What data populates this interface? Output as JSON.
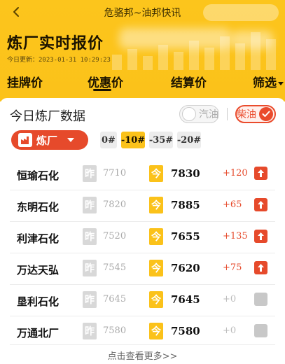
{
  "nav": {
    "title": "危骆邦~油邦快讯"
  },
  "header": {
    "title": "炼厂实时报价",
    "update_text": "今日更新：2023-01-31 10:29:23"
  },
  "tabs": [
    {
      "label": "挂牌价"
    },
    {
      "label": "优惠价"
    },
    {
      "label": "结算价"
    },
    {
      "label": "筛选"
    }
  ],
  "active_tab": "优惠价",
  "section": {
    "title": "今日炼厂数据"
  },
  "fuel_toggle": {
    "gasoline_label": "汽油",
    "diesel_label": "柴油",
    "selected": "柴油"
  },
  "refinery_filter": {
    "label": "炼厂"
  },
  "grades": [
    {
      "label": "0#"
    },
    {
      "label": "-10#"
    },
    {
      "label": "-35#"
    },
    {
      "label": "-20#"
    }
  ],
  "selected_grade": "-10#",
  "badges": {
    "yesterday": "昨",
    "today": "今"
  },
  "rows": [
    {
      "name": "恒瑜石化",
      "yesterday": "7710",
      "today": "7830",
      "change": "+120",
      "trend": "up"
    },
    {
      "name": "东明石化",
      "yesterday": "7820",
      "today": "7885",
      "change": "+65",
      "trend": "up"
    },
    {
      "name": "利津石化",
      "yesterday": "7520",
      "today": "7655",
      "change": "+135",
      "trend": "up"
    },
    {
      "name": "万达天弘",
      "yesterday": "7545",
      "today": "7620",
      "change": "+75",
      "trend": "up"
    },
    {
      "name": "垦利石化",
      "yesterday": "7645",
      "today": "7645",
      "change": "+0",
      "trend": "flat"
    },
    {
      "name": "万通北厂",
      "yesterday": "7580",
      "today": "7580",
      "change": "+0",
      "trend": "flat"
    }
  ],
  "more_link": "点击查看更多>>",
  "colors": {
    "brand_yellow": "#fbc21a",
    "accent_red": "#e64a2b",
    "muted_gray": "#c8c8c8"
  }
}
